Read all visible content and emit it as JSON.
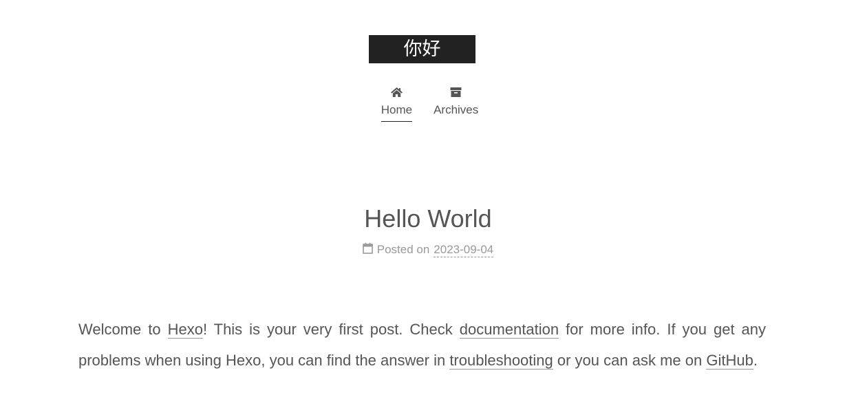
{
  "site": {
    "title": "你好"
  },
  "nav": {
    "items": [
      {
        "label": "Home",
        "icon": "home-icon",
        "active": true
      },
      {
        "label": "Archives",
        "icon": "archive-icon",
        "active": false
      }
    ]
  },
  "post": {
    "title": "Hello World",
    "meta_prefix": "Posted on",
    "date": "2023-09-04",
    "body": {
      "t1": "Welcome to ",
      "link_hexo": "Hexo",
      "t2": "! This is your very first post. Check ",
      "link_docs": "documentation",
      "t3": " for more info. If you get any problems when using Hexo, you can find the answer in ",
      "link_troubleshooting": "troubleshooting",
      "t4": " or you can ask me on ",
      "link_github": "GitHub",
      "t5": "."
    }
  },
  "colors": {
    "brand_bg": "#222222",
    "text": "#555555",
    "meta": "#999999",
    "background": "#ffffff"
  }
}
